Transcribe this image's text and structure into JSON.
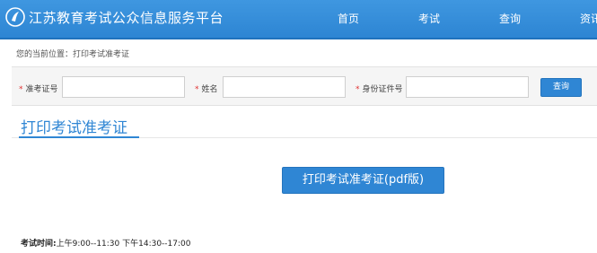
{
  "header": {
    "site_title": "江苏教育考试公众信息服务平台",
    "nav": [
      "首页",
      "考试",
      "查询",
      "资讯"
    ]
  },
  "breadcrumb": "您的当前位置：打印考试准考证",
  "search": {
    "fields": [
      {
        "label": "准考证号",
        "value": "",
        "placeholder": ""
      },
      {
        "label": "姓名",
        "value": "",
        "placeholder": ""
      },
      {
        "label": "身份证件号",
        "value": "",
        "placeholder": ""
      }
    ],
    "required_mark": "*",
    "button": "查询"
  },
  "section": {
    "title": "打印考试准考证",
    "print_button": "打印考试准考证(pdf版)"
  },
  "exam_time": {
    "label": "考试时间:",
    "value": "上午9:00--11:30 下午14:30--17:00"
  },
  "colors": {
    "header_bg": "#2d85d3",
    "accent": "#2f86d4",
    "required": "#e03030"
  }
}
